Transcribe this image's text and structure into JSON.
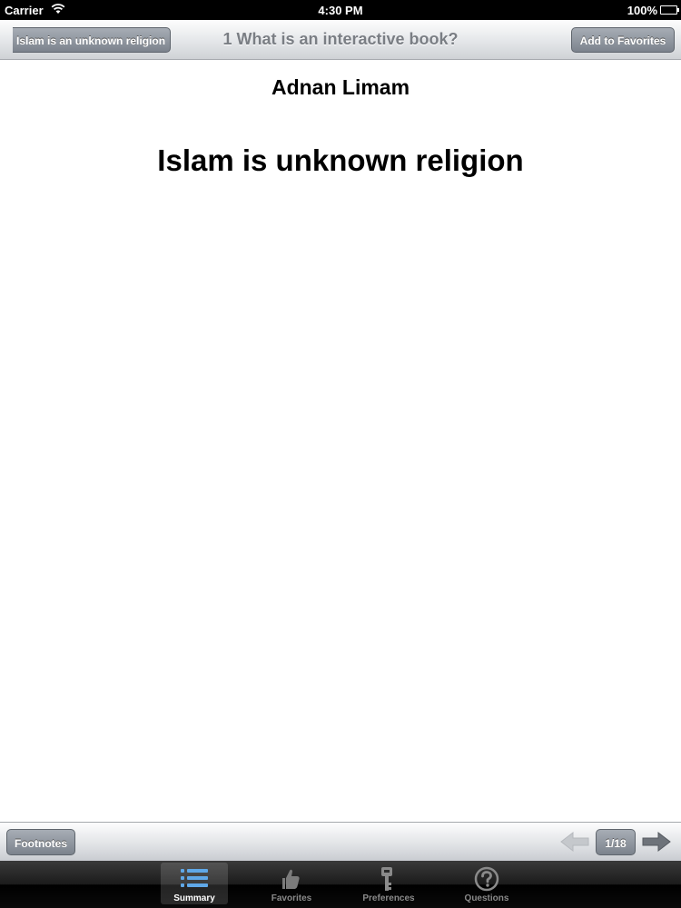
{
  "status_bar": {
    "carrier": "Carrier",
    "time": "4:30 PM",
    "battery": "100%"
  },
  "nav_bar": {
    "back_label": "Islam is an unknown religion",
    "title": "1 What is an interactive book?",
    "favorite_label": "Add to Favorites"
  },
  "content": {
    "author": "Adnan Limam",
    "title": "Islam is unknown religion"
  },
  "toolbar": {
    "footnotes_label": "Footnotes",
    "page_indicator": "1/18"
  },
  "tabs": [
    {
      "label": "Summary",
      "icon": "list-icon",
      "active": true
    },
    {
      "label": "Favorites",
      "icon": "thumbs-up-icon",
      "active": false
    },
    {
      "label": "Preferences",
      "icon": "key-icon",
      "active": false
    },
    {
      "label": "Questions",
      "icon": "question-icon",
      "active": false
    }
  ],
  "colors": {
    "button_gray": "#8e949c",
    "tab_active_icon": "#5fa8e8",
    "tab_inactive": "#8a8a8a"
  }
}
